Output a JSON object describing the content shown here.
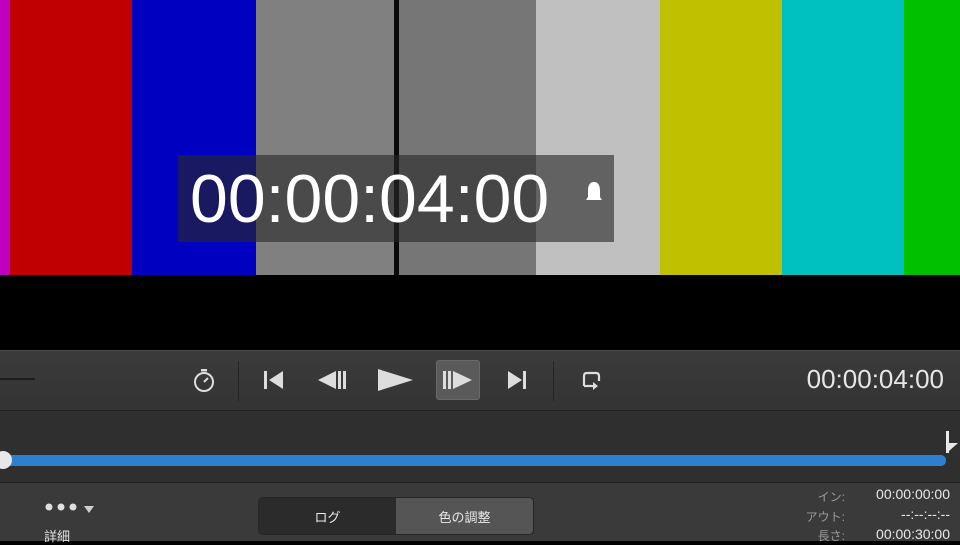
{
  "colors": {
    "magenta": "#c000c0",
    "red": "#c00000",
    "blue": "#0000c0",
    "gray_dark": "#808080",
    "gray_mid": "#767676",
    "white_gray": "#c0c0c0",
    "yellow": "#c0c000",
    "cyan": "#00c0c0",
    "green": "#00c000",
    "accent_blue": "#2f7fcf"
  },
  "preview": {
    "overlay_timecode": "00:00:04:00"
  },
  "transport": {
    "current_time": "00:00:04:00",
    "icons": [
      "stopwatch-icon",
      "go-to-start-icon",
      "previous-frame-icon",
      "play-icon",
      "next-frame-icon",
      "go-to-end-icon",
      "loop-icon"
    ]
  },
  "timeline": {
    "progress": 0.0
  },
  "bottom": {
    "details_label": "詳細",
    "tabs": [
      "ログ",
      "色の調整"
    ],
    "in_label": "イン:",
    "in_value": "00:00:00:00",
    "out_label": "アウト:",
    "out_value": "--:--:--:--",
    "length_label": "長さ:",
    "length_value": "00:00:30:00"
  }
}
